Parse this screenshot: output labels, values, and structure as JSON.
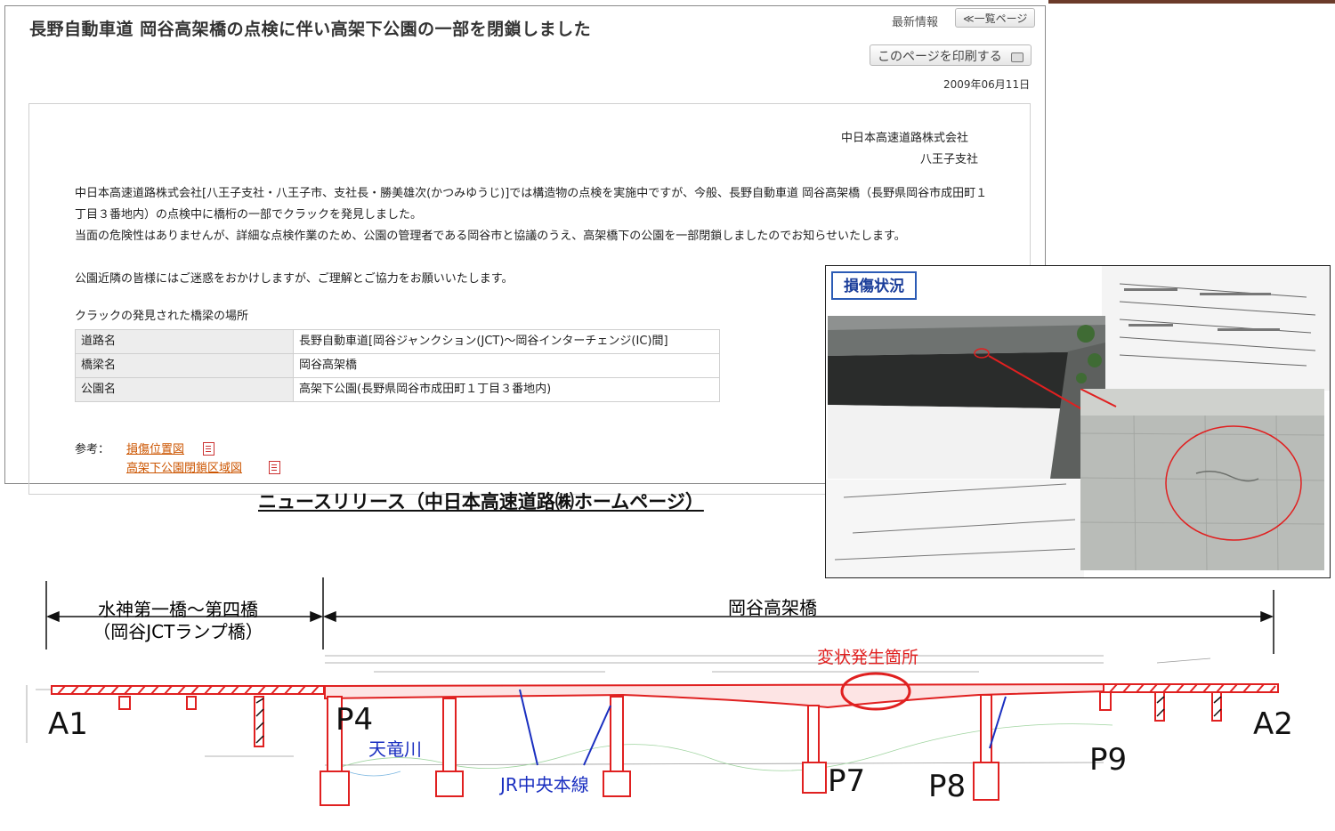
{
  "news": {
    "title": "長野自動車道 岡谷高架橋の点検に伴い高架下公園の一部を閉鎖しました",
    "latest_label": "最新情報",
    "list_button": "≪一覧ページ",
    "print_button": "このページを印刷する",
    "date": "2009年06月11日",
    "company": "中日本高速道路株式会社",
    "branch": "八王子支社",
    "paragraphs": [
      "中日本高速道路株式会社[八王子支社・八王子市、支社長・勝美雄次(かつみゆうじ)]では構造物の点検を実施中ですが、今般、長野自動車道 岡谷高架橋（長野県岡谷市成田町１丁目３番地内）の点検中に橋桁の一部でクラックを発見しました。",
      "当面の危険性はありませんが、詳細な点検作業のため、公園の管理者である岡谷市と協議のうえ、高架橋下の公園を一部閉鎖しましたのでお知らせいたします。",
      "公園近隣の皆様にはご迷惑をおかけしますが、ご理解とご協力をお願いいたします。"
    ],
    "table_caption": "クラックの発見された橋梁の場所",
    "table": [
      {
        "header": "道路名",
        "value": "長野自動車道[岡谷ジャンクション(JCT)～岡谷インターチェンジ(IC)間]"
      },
      {
        "header": "橋梁名",
        "value": "岡谷高架橋"
      },
      {
        "header": "公園名",
        "value": "高架下公園(長野県岡谷市成田町１丁目３番地内)"
      }
    ],
    "ref_label": "参考：",
    "ref_links": [
      "損傷位置図",
      "高架下公園閉鎖区域図"
    ],
    "caption": "ニュースリリース（中日本高速道路㈱ホームページ）"
  },
  "damage": {
    "label": "損傷状況",
    "highlight_color": "#e02020",
    "label_color": "#2b5bb5"
  },
  "diagram": {
    "span_left": "水神第一橋～第四橋",
    "span_left_sub": "（岡谷JCTランプ橋）",
    "span_right": "岡谷高架橋",
    "defect_label": "変状発生箇所",
    "piers": [
      "A1",
      "P4",
      "P7",
      "P8",
      "P9",
      "A2"
    ],
    "river_label": "天竜川",
    "rail_label": "JR中央本線",
    "colors": {
      "girder": "#e02020",
      "label_blue": "#1a2fc0"
    }
  }
}
